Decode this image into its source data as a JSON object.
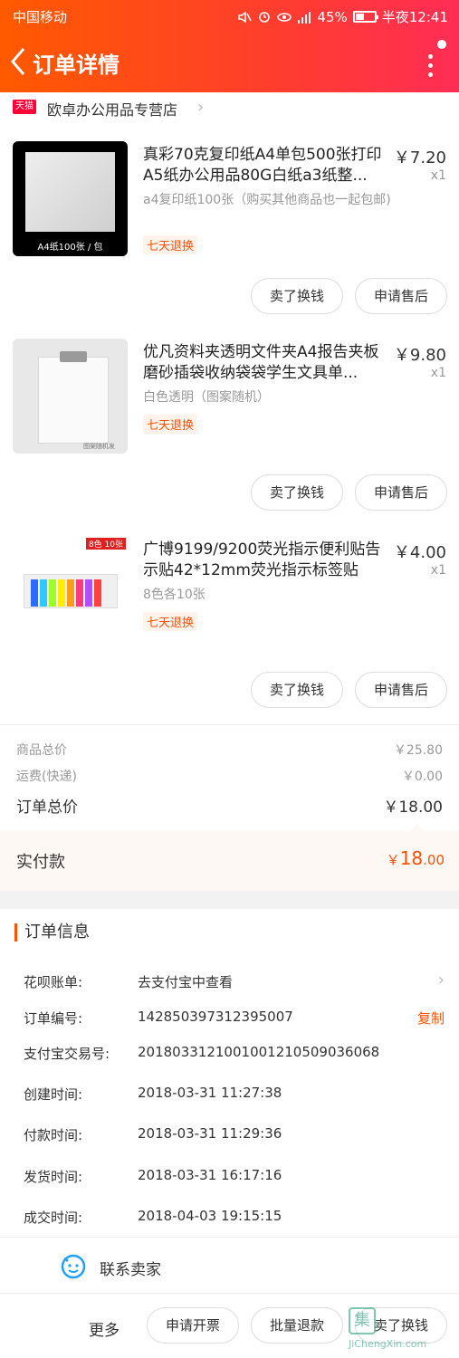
{
  "status": {
    "carrier": "中国移动",
    "battery": "45%",
    "time": "半夜12:41"
  },
  "nav": {
    "title": "订单详情"
  },
  "store": {
    "badge": "天猫",
    "name": "欧卓办公用品专营店"
  },
  "items": [
    {
      "title": "真彩70克复印纸A4单包500张打印A5纸办公用品80G白纸a3纸整...",
      "price": "￥7.20",
      "qty": "x1",
      "sku": "a4复印纸100张（购买其他商品也一起包邮)",
      "tag": "七天退换",
      "thumb_caption": "A4纸100张 / 包",
      "btn_sell": "卖了换钱",
      "btn_after": "申请售后"
    },
    {
      "title": "优凡资料夹透明文件夹A4报告夹板磨砂插袋收纳袋袋学生文具单...",
      "price": "￥9.80",
      "qty": "x1",
      "sku": "白色透明（图案随机）",
      "tag": "七天退换",
      "thumb_caption": "图案随机发",
      "btn_sell": "卖了换钱",
      "btn_after": "申请售后"
    },
    {
      "title": "广博9199/9200荧光指示便利贴告示贴42*12mm荧光指示标签贴",
      "price": "￥4.00",
      "qty": "x1",
      "sku": "8色各10张",
      "tag": "七天退换",
      "thumb_caption": "8色 10张",
      "btn_sell": "卖了换钱",
      "btn_after": "申请售后"
    }
  ],
  "totals": {
    "goods_label": "商品总价",
    "goods_value": "￥25.80",
    "ship_label": "运费(快递)",
    "ship_value": "￥0.00",
    "order_label": "订单总价",
    "order_value": "￥18.00",
    "paid_label": "实付款",
    "paid_int": "18",
    "paid_dec": ".00",
    "paid_symbol": "￥"
  },
  "order_info": {
    "title": "订单信息",
    "huabei_label": "花呗账单:",
    "huabei_value": "去支付宝中查看",
    "order_no_label": "订单编号:",
    "order_no_value": "142850397312395007",
    "copy": "复制",
    "alipay_label": "支付宝交易号:",
    "alipay_value": "2018033121001001210509036068",
    "created_label": "创建时间:",
    "created_value": "2018-03-31 11:27:38",
    "paid_label": "付款时间:",
    "paid_value": "2018-03-31 11:29:36",
    "shipped_label": "发货时间:",
    "shipped_value": "2018-03-31 16:17:16",
    "done_label": "成交时间:",
    "done_value": "2018-04-03 19:15:15"
  },
  "contact": {
    "label": "联系卖家"
  },
  "bottom": {
    "more": "更多",
    "invoice": "申请开票",
    "batch_refund": "批量退款",
    "sell": "卖了换钱"
  },
  "watermark": {
    "text": "JiChengXin.com",
    "logo": "集"
  },
  "colors": {
    "accent": "#ff5000",
    "header_start": "#ff5a00",
    "header_end": "#ff2d55"
  }
}
